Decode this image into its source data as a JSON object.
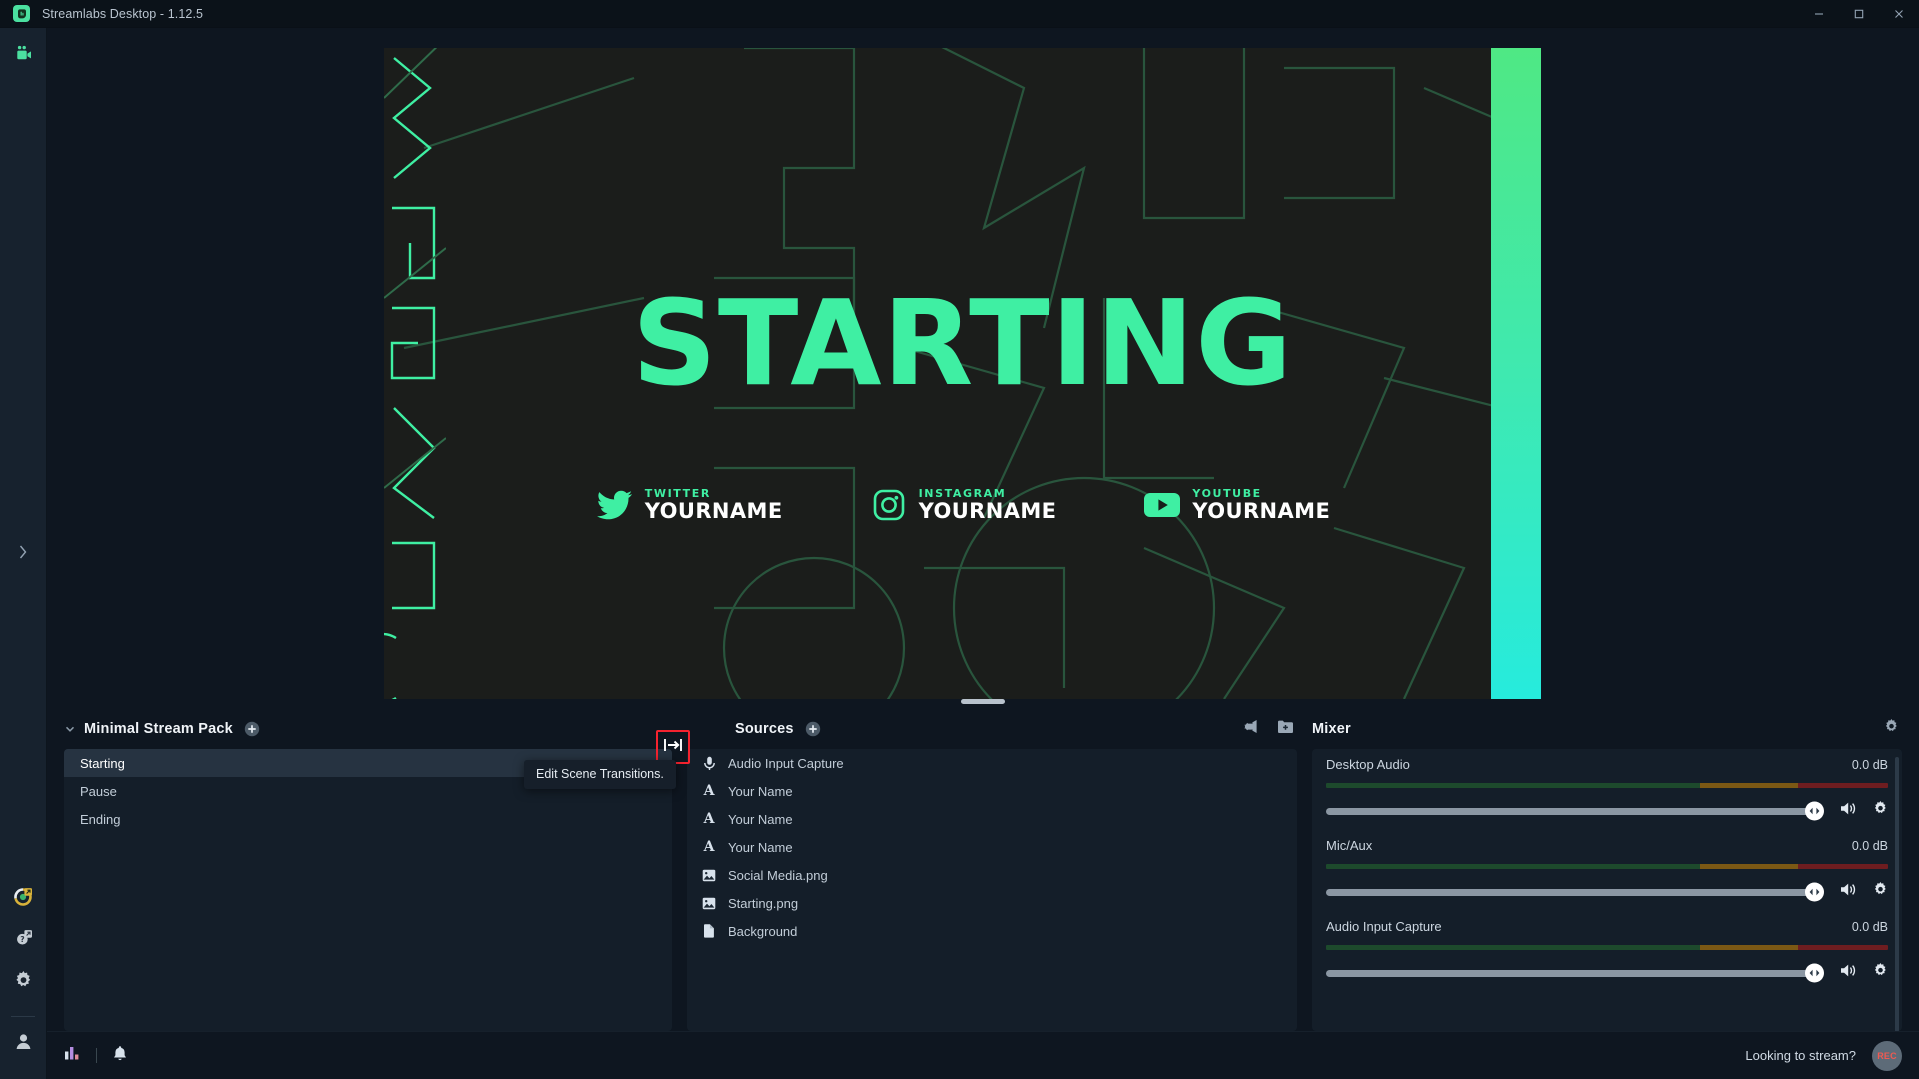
{
  "window": {
    "title": "Streamlabs Desktop - 1.12.5",
    "logo_icon": "streamlabs-logo-icon",
    "controls": [
      {
        "name": "minimize-button",
        "icon": "minimize-icon"
      },
      {
        "name": "maximize-button",
        "icon": "maximize-icon"
      },
      {
        "name": "close-button",
        "icon": "close-icon"
      }
    ]
  },
  "nav": {
    "top_items": [
      {
        "name": "editor",
        "icon": "video-camera-icon",
        "active": true
      }
    ],
    "bottom_items": [
      {
        "name": "themes",
        "icon": "themes-launch-icon"
      },
      {
        "name": "help",
        "icon": "help-launch-icon"
      },
      {
        "name": "settings",
        "icon": "gear-icon"
      },
      {
        "name": "account",
        "icon": "user-icon"
      }
    ],
    "expand_icon": "chevron-right-icon"
  },
  "preview": {
    "headline": "STARTING",
    "headline_color": "#3fefa3",
    "background_color": "#1b1d1b",
    "gradient_from": "#4fe884",
    "gradient_to": "#26ebdd",
    "socials": [
      {
        "platform": "TWITTER",
        "handle": "YOURNAME",
        "icon": "twitter-icon"
      },
      {
        "platform": "INSTAGRAM",
        "handle": "YOURNAME",
        "icon": "instagram-icon"
      },
      {
        "platform": "YOUTUBE",
        "handle": "YOURNAME",
        "icon": "youtube-icon"
      }
    ]
  },
  "scenes": {
    "title": "Minimal Stream Pack",
    "collapse_icon": "chevron-down-icon",
    "add_icon": "add-circle-icon",
    "items": [
      {
        "label": "Starting",
        "selected": true
      },
      {
        "label": "Pause",
        "selected": false
      },
      {
        "label": "Ending",
        "selected": false
      }
    ]
  },
  "transitions": {
    "icon": "scene-transitions-icon",
    "tooltip": "Edit Scene Transitions.",
    "highlight_color": "#f5232f"
  },
  "sources": {
    "title": "Sources",
    "add_icon": "add-circle-icon",
    "projector_icon": "projector-icon",
    "add_folder_icon": "add-folder-icon",
    "items": [
      {
        "label": "Audio Input Capture",
        "icon": "microphone-icon"
      },
      {
        "label": "Your Name",
        "icon": "text-icon"
      },
      {
        "label": "Your Name",
        "icon": "text-icon"
      },
      {
        "label": "Your Name",
        "icon": "text-icon"
      },
      {
        "label": "Social Media.png",
        "icon": "image-icon"
      },
      {
        "label": "Starting.png",
        "icon": "image-icon"
      },
      {
        "label": "Background",
        "icon": "document-icon"
      }
    ]
  },
  "mixer": {
    "title": "Mixer",
    "settings_icon": "gear-icon",
    "channels": [
      {
        "name": "Desktop Audio",
        "db": "0.0 dB",
        "volume_pct": 100,
        "mute_icon": "speaker-icon",
        "settings_icon": "gear-icon"
      },
      {
        "name": "Mic/Aux",
        "db": "0.0 dB",
        "volume_pct": 100,
        "mute_icon": "speaker-icon",
        "settings_icon": "gear-icon"
      },
      {
        "name": "Audio Input Capture",
        "db": "0.0 dB",
        "volume_pct": 100,
        "mute_icon": "speaker-icon",
        "settings_icon": "gear-icon"
      }
    ]
  },
  "status": {
    "performance_icon": "performance-chart-icon",
    "notifications_icon": "bell-icon",
    "prompt": "Looking to stream?",
    "record_label": "REC"
  }
}
